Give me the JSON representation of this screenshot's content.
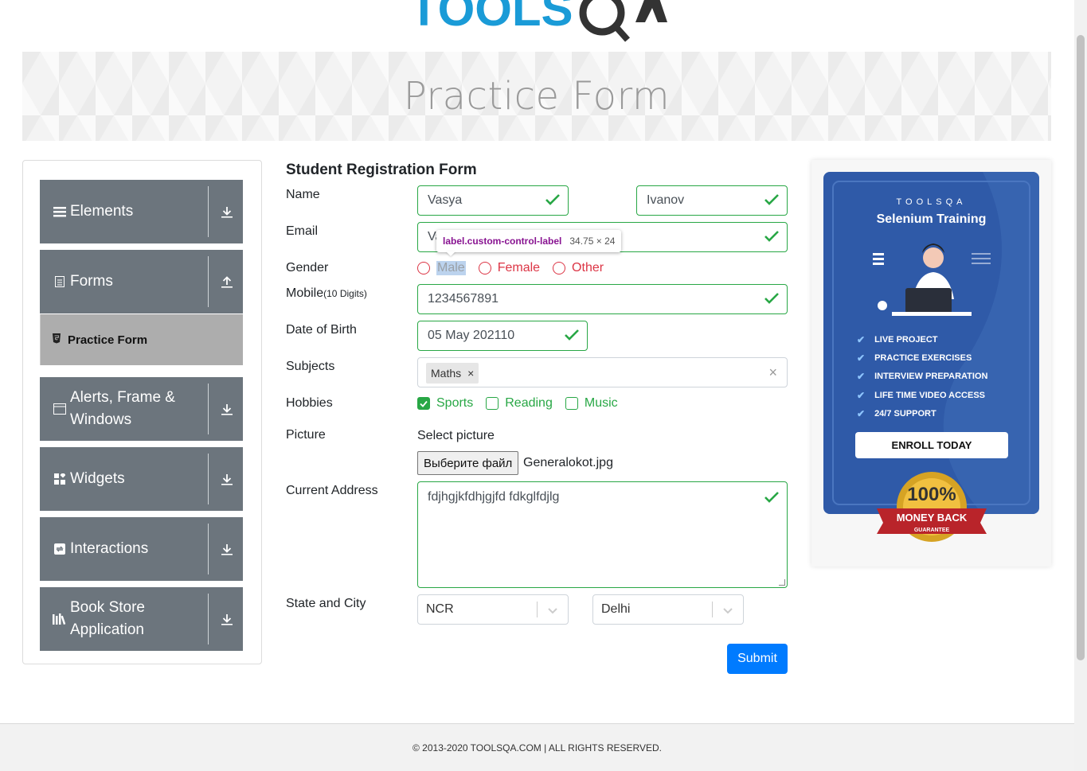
{
  "logo": {
    "text": "TOOLSQA"
  },
  "banner": {
    "title": "Practice Form"
  },
  "sidebar": {
    "groups": [
      {
        "label": "Elements",
        "icon": "hamburger-icon",
        "toggle": "download-arrow-icon"
      },
      {
        "label": "Forms",
        "icon": "document-icon",
        "toggle": "upload-arrow-icon"
      },
      {
        "label": "Alerts, Frame & Windows",
        "icon": "window-icon",
        "toggle": "download-arrow-icon"
      },
      {
        "label": "Widgets",
        "icon": "widgets-icon",
        "toggle": "download-arrow-icon"
      },
      {
        "label": "Interactions",
        "icon": "interactions-icon",
        "toggle": "download-arrow-icon"
      },
      {
        "label": "Book Store Application",
        "icon": "books-icon",
        "toggle": "download-arrow-icon"
      }
    ],
    "active_item": "Practice Form"
  },
  "form": {
    "title": "Student Registration Form",
    "labels": {
      "name": "Name",
      "email": "Email",
      "gender": "Gender",
      "mobile": "Mobile",
      "mobile_hint": "(10 Digits)",
      "dob": "Date of Birth",
      "subjects": "Subjects",
      "hobbies": "Hobbies",
      "picture": "Picture",
      "address": "Current Address",
      "state_city": "State and City"
    },
    "first_name": "Vasya",
    "last_name": "Ivanov",
    "email_visible": "Va",
    "gender_options": [
      "Male",
      "Female",
      "Other"
    ],
    "mobile": "1234567891",
    "dob": "05 May 202110",
    "subjects": [
      "Maths"
    ],
    "subject_remove": "×",
    "subjects_clear": "×",
    "hobbies": [
      {
        "label": "Sports",
        "checked": true
      },
      {
        "label": "Reading",
        "checked": false
      },
      {
        "label": "Music",
        "checked": false
      }
    ],
    "picture_label": "Select picture",
    "file_button": "Выберите файл",
    "file_name": "Generalokot.jpg",
    "address": "fdjhgjkfdhjgjfd fdkglfdjlg",
    "state": "NCR",
    "city": "Delhi",
    "submit": "Submit"
  },
  "tooltip": {
    "selector": "label.custom-control-label",
    "dimensions": "34.75 × 24"
  },
  "ad": {
    "brand": "TOOLSQA",
    "headline": "Selenium Training",
    "features": [
      "LIVE PROJECT",
      "PRACTICE EXERCISES",
      "INTERVIEW PREPARATION",
      "LIFE TIME VIDEO ACCESS",
      "24/7 SUPPORT"
    ],
    "cta": "ENROLL TODAY",
    "badge_top": "100%",
    "badge_mid": "MONEY BACK",
    "badge_bottom": "GUARANTEE"
  },
  "footer": {
    "text": "© 2013-2020 TOOLSQA.COM | ALL RIGHTS RESERVED."
  },
  "colors": {
    "valid": "#28a745",
    "invalid": "#dc3545",
    "primary": "#007bff",
    "sidebar": "#6c757d",
    "ad": "#2f5aa8"
  }
}
